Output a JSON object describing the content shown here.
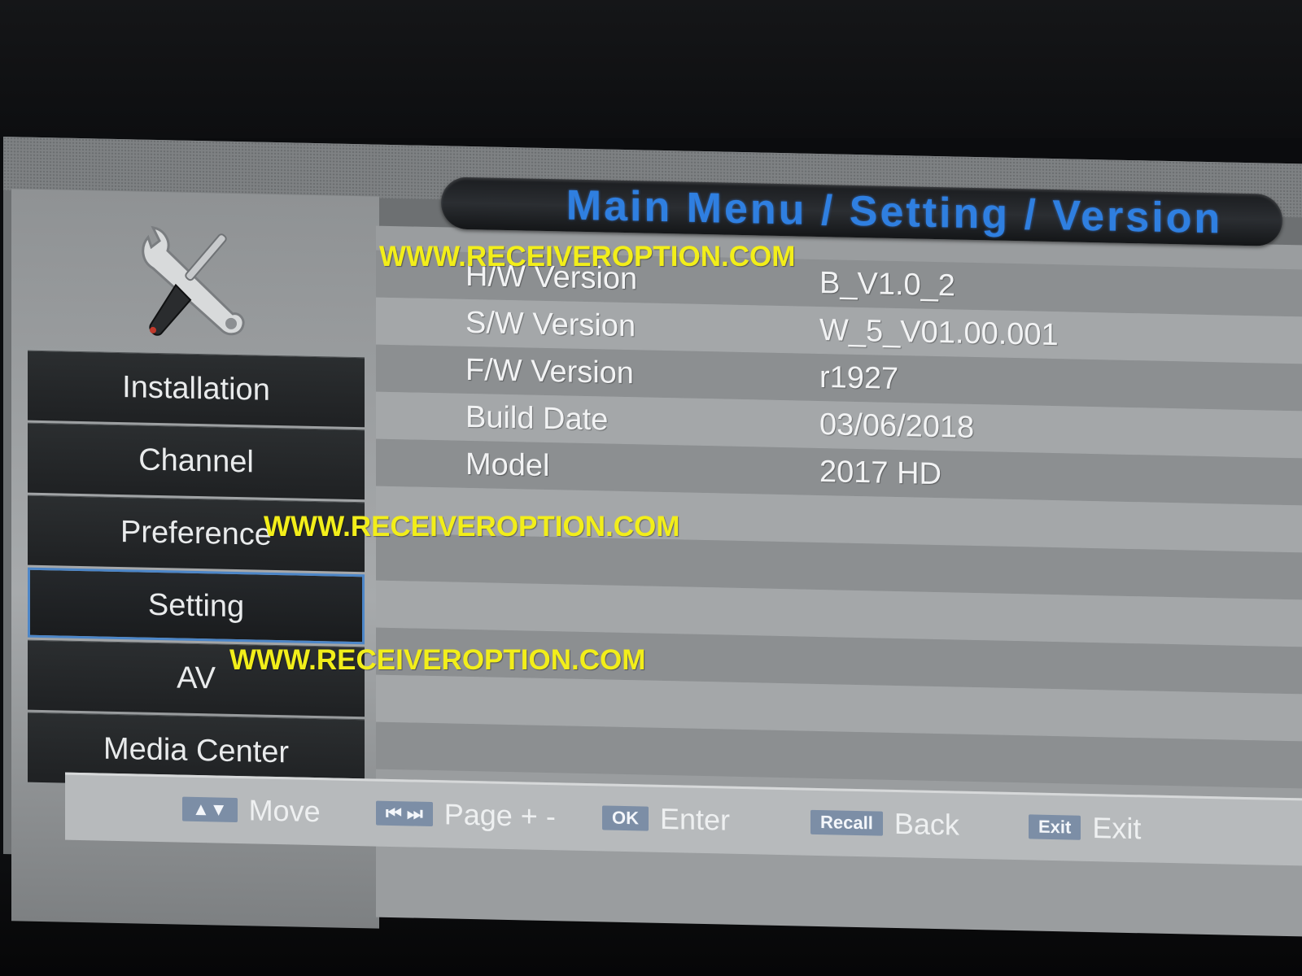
{
  "title": "Main Menu / Setting / Version",
  "menu": {
    "items": [
      {
        "label": "Installation"
      },
      {
        "label": "Channel"
      },
      {
        "label": "Preference"
      },
      {
        "label": "Setting",
        "active": true
      },
      {
        "label": "AV"
      },
      {
        "label": "Media Center"
      }
    ]
  },
  "version_info": [
    {
      "label": "H/W Version",
      "value": "B_V1.0_2"
    },
    {
      "label": "S/W Version",
      "value": "W_5_V01.00.001"
    },
    {
      "label": "F/W Version",
      "value": "r1927"
    },
    {
      "label": "Build Date",
      "value": "03/06/2018"
    },
    {
      "label": "Model",
      "value": "2017 HD"
    }
  ],
  "footer": {
    "hints": [
      {
        "key": "▲▼",
        "label": "Move"
      },
      {
        "key": "⏮ ⏭",
        "label": "Page + -"
      },
      {
        "key": "OK",
        "label": "Enter"
      },
      {
        "key": "Recall",
        "label": "Back"
      },
      {
        "key": "Exit",
        "label": "Exit"
      }
    ]
  },
  "watermark": "WWW.RECEIVEROPTION.COM",
  "colors": {
    "title_text": "#2f7fe0",
    "watermark": "#f2ee1a",
    "active_border": "#4c86c8"
  },
  "icons": {
    "header": "tools-icon"
  }
}
